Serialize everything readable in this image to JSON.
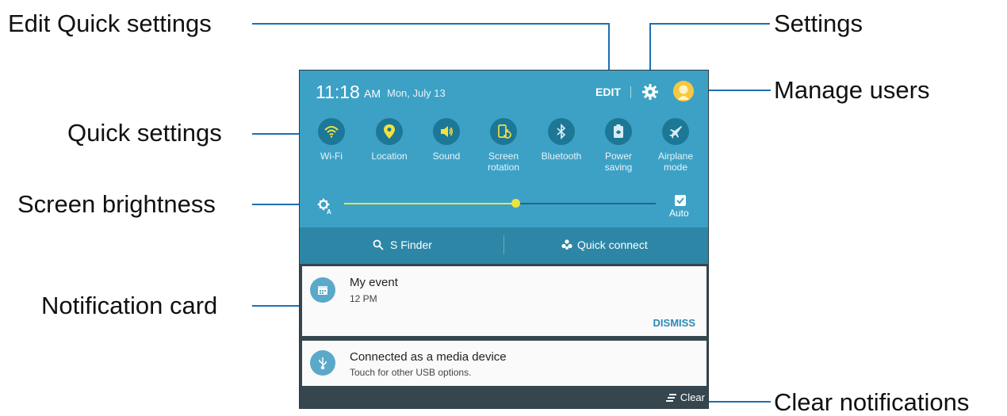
{
  "callouts": {
    "edit_quick_settings": "Edit Quick settings",
    "settings": "Settings",
    "manage_users": "Manage users",
    "quick_settings": "Quick settings",
    "screen_brightness": "Screen brightness",
    "notification_card": "Notification card",
    "clear_notifications": "Clear notifications"
  },
  "status": {
    "time": "11:18",
    "ampm": "AM",
    "date": "Mon, July 13",
    "edit_label": "EDIT"
  },
  "quick_settings": [
    {
      "label": "Wi-Fi",
      "icon": "wifi-icon",
      "active": true
    },
    {
      "label": "Location",
      "icon": "location-icon",
      "active": true
    },
    {
      "label": "Sound",
      "icon": "sound-icon",
      "active": true
    },
    {
      "label": "Screen\nrotation",
      "icon": "screen-rotation-icon",
      "active": true
    },
    {
      "label": "Bluetooth",
      "icon": "bluetooth-icon",
      "active": false
    },
    {
      "label": "Power\nsaving",
      "icon": "power-saving-icon",
      "active": false
    },
    {
      "label": "Airplane\nmode",
      "icon": "airplane-icon",
      "active": false
    }
  ],
  "brightness": {
    "level": 0.55,
    "auto_label": "Auto",
    "auto_checked": true
  },
  "finder": {
    "sfinder_label": "S Finder",
    "quickconnect_label": "Quick connect"
  },
  "notifications": [
    {
      "title": "My event",
      "subtitle": "12 PM",
      "action": "DISMISS",
      "icon": "calendar-icon"
    },
    {
      "title": "Connected as a media device",
      "subtitle": "Touch for other USB options.",
      "icon": "usb-icon"
    }
  ],
  "bottom": {
    "clear_label": "Clear"
  },
  "colors": {
    "panel_blue": "#3da1c6",
    "tile_circle_active_glyph": "#f2e23d",
    "tile_circle_inactive_glyph": "#d7ecf4",
    "leader_line": "#1f6fb2",
    "dismiss": "#2b89b5"
  }
}
